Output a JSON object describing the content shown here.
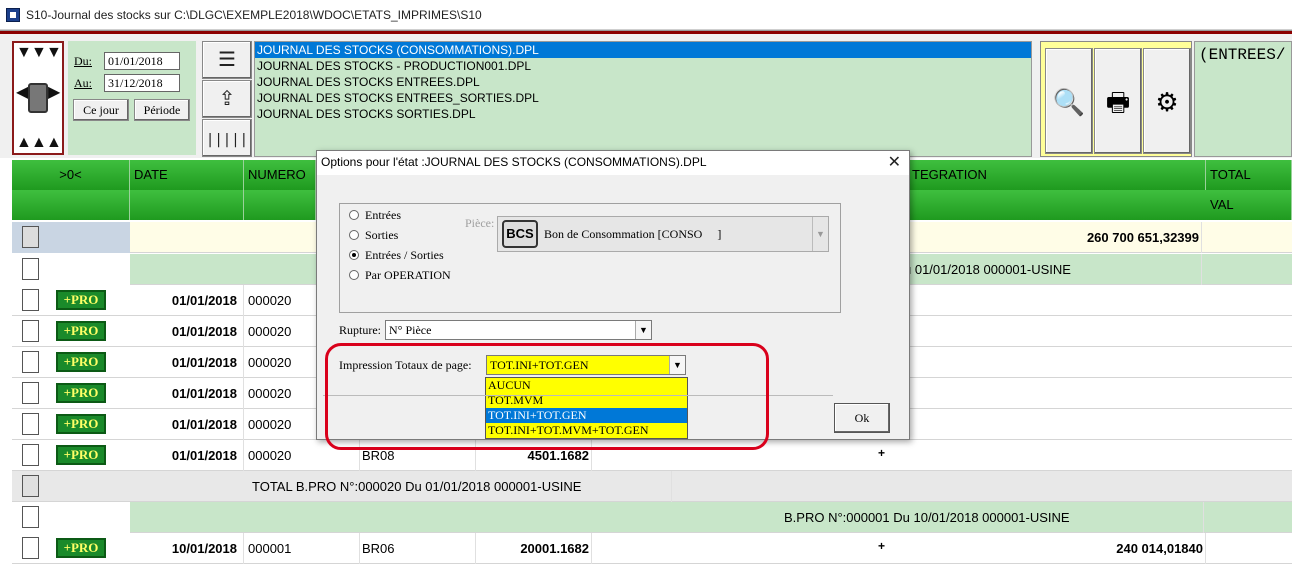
{
  "window": {
    "title": "S10-Journal des stocks sur C:\\DLGC\\EXEMPLE2018\\WDOC\\ETATS_IMPRIMES\\S10"
  },
  "filters": {
    "du_label": "Du:",
    "du_value": "01/01/2018",
    "au_label": "Au:",
    "au_value": "31/12/2018",
    "ce_jour_label": "Ce jour",
    "periode_label": "Période"
  },
  "files": [
    "JOURNAL DES STOCKS (CONSOMMATIONS).DPL",
    "JOURNAL DES STOCKS - PRODUCTION001.DPL",
    "JOURNAL DES STOCKS ENTREES.DPL",
    "JOURNAL DES STOCKS ENTREES_SORTIES.DPL",
    "JOURNAL DES STOCKS SORTIES.DPL"
  ],
  "right_panel_text": "(ENTREES/",
  "grid": {
    "headers": [
      ">0<",
      "DATE",
      "NUMERO",
      "TEGRATION",
      "TOTAL"
    ],
    "subheader_val": "VAL",
    "total_top": "260 700 651,32399",
    "group1_header": "u 01/01/2018  000001-USINE",
    "rows": [
      {
        "date": "01/01/2018",
        "num": "000020"
      },
      {
        "date": "01/01/2018",
        "num": "000020"
      },
      {
        "date": "01/01/2018",
        "num": "000020"
      },
      {
        "date": "01/01/2018",
        "num": "000020"
      },
      {
        "date": "01/01/2018",
        "num": "000020"
      },
      {
        "date": "01/01/2018",
        "num": "000020",
        "ref": "BR08",
        "qty": "4501.1682"
      }
    ],
    "pro_label": "+PRO",
    "group1_total": "TOTAL B.PRO  N°:000020  Du 01/01/2018  000001-USINE",
    "group2_header": "B.PRO  N°:000001  Du 10/01/2018  000001-USINE",
    "last_row": {
      "date": "10/01/2018",
      "num": "000001",
      "ref": "BR06",
      "qty": "20001.1682",
      "total": "240 014,01840"
    }
  },
  "dialog": {
    "title": "Options pour l'état :JOURNAL DES STOCKS (CONSOMMATIONS).DPL",
    "radios": [
      "Entrées",
      "Sorties",
      "Entrées / Sorties",
      "Par OPERATION"
    ],
    "selected_radio": "Entrées / Sorties",
    "piece_label": "Pièce:",
    "piece_icon": "BCS",
    "piece_value": "Bon de Consommation [CONSO     ]",
    "rupture_label": "Rupture:",
    "rupture_value": "N° Pièce",
    "impression_label": "Impression Totaux de page:",
    "impression_value": "TOT.INI+TOT.GEN",
    "impression_options": [
      "AUCUN",
      "TOT.MVM",
      "TOT.INI+TOT.GEN",
      "TOT.INI+TOT.MVM+TOT.GEN"
    ],
    "impression_selected": "TOT.INI+TOT.GEN",
    "ok_label": "Ok",
    "highlight_color": "#d9001b"
  }
}
